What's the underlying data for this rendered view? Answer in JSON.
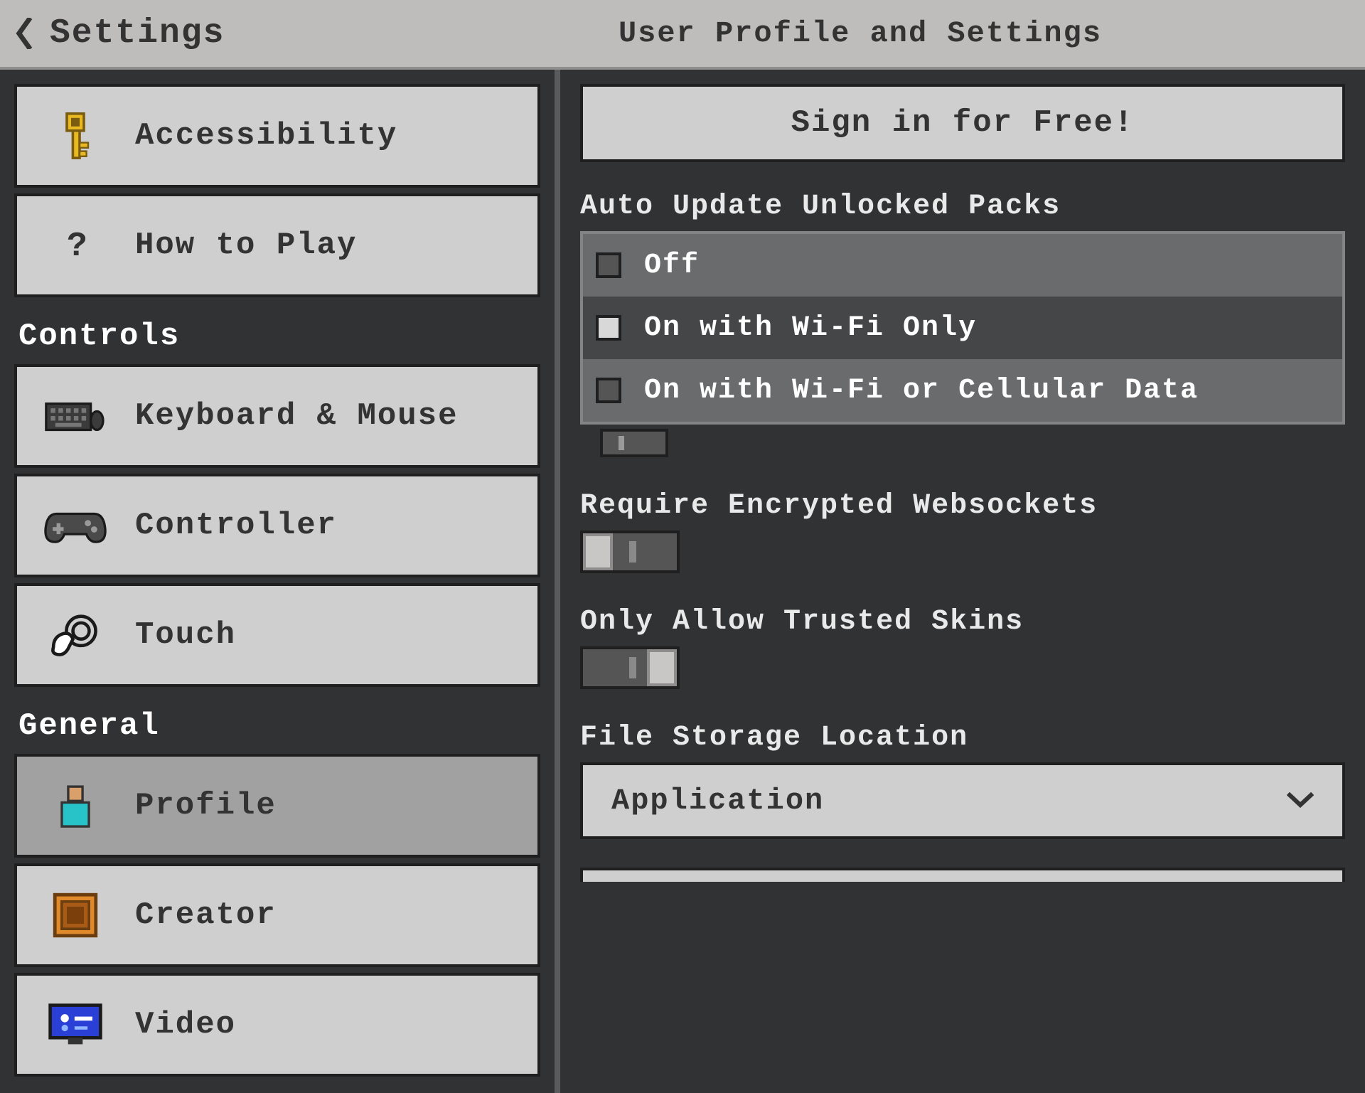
{
  "header": {
    "back_title": "Settings",
    "page_title": "User Profile and Settings"
  },
  "sidebar": {
    "items": [
      {
        "label": "Accessibility",
        "icon": "key-icon"
      },
      {
        "label": "How to Play",
        "icon": "question-icon"
      }
    ],
    "section_controls": "Controls",
    "controls": [
      {
        "label": "Keyboard & Mouse",
        "icon": "keyboard-icon"
      },
      {
        "label": "Controller",
        "icon": "gamepad-icon"
      },
      {
        "label": "Touch",
        "icon": "touch-icon"
      }
    ],
    "section_general": "General",
    "general": [
      {
        "label": "Profile",
        "icon": "profile-icon",
        "selected": true
      },
      {
        "label": "Creator",
        "icon": "creator-icon"
      },
      {
        "label": "Video",
        "icon": "video-icon"
      }
    ]
  },
  "content": {
    "sign_in": "Sign in for Free!",
    "auto_update_label": "Auto Update Unlocked Packs",
    "auto_update_options": [
      {
        "label": "Off",
        "checked": false
      },
      {
        "label": "On with Wi-Fi Only",
        "checked": true
      },
      {
        "label": "On with Wi-Fi or Cellular Data",
        "checked": false
      }
    ],
    "websockets_label": "Require Encrypted Websockets",
    "websockets_on": false,
    "trusted_skins_label": "Only Allow Trusted Skins",
    "trusted_skins_on": true,
    "storage_label": "File Storage Location",
    "storage_value": "Application"
  }
}
